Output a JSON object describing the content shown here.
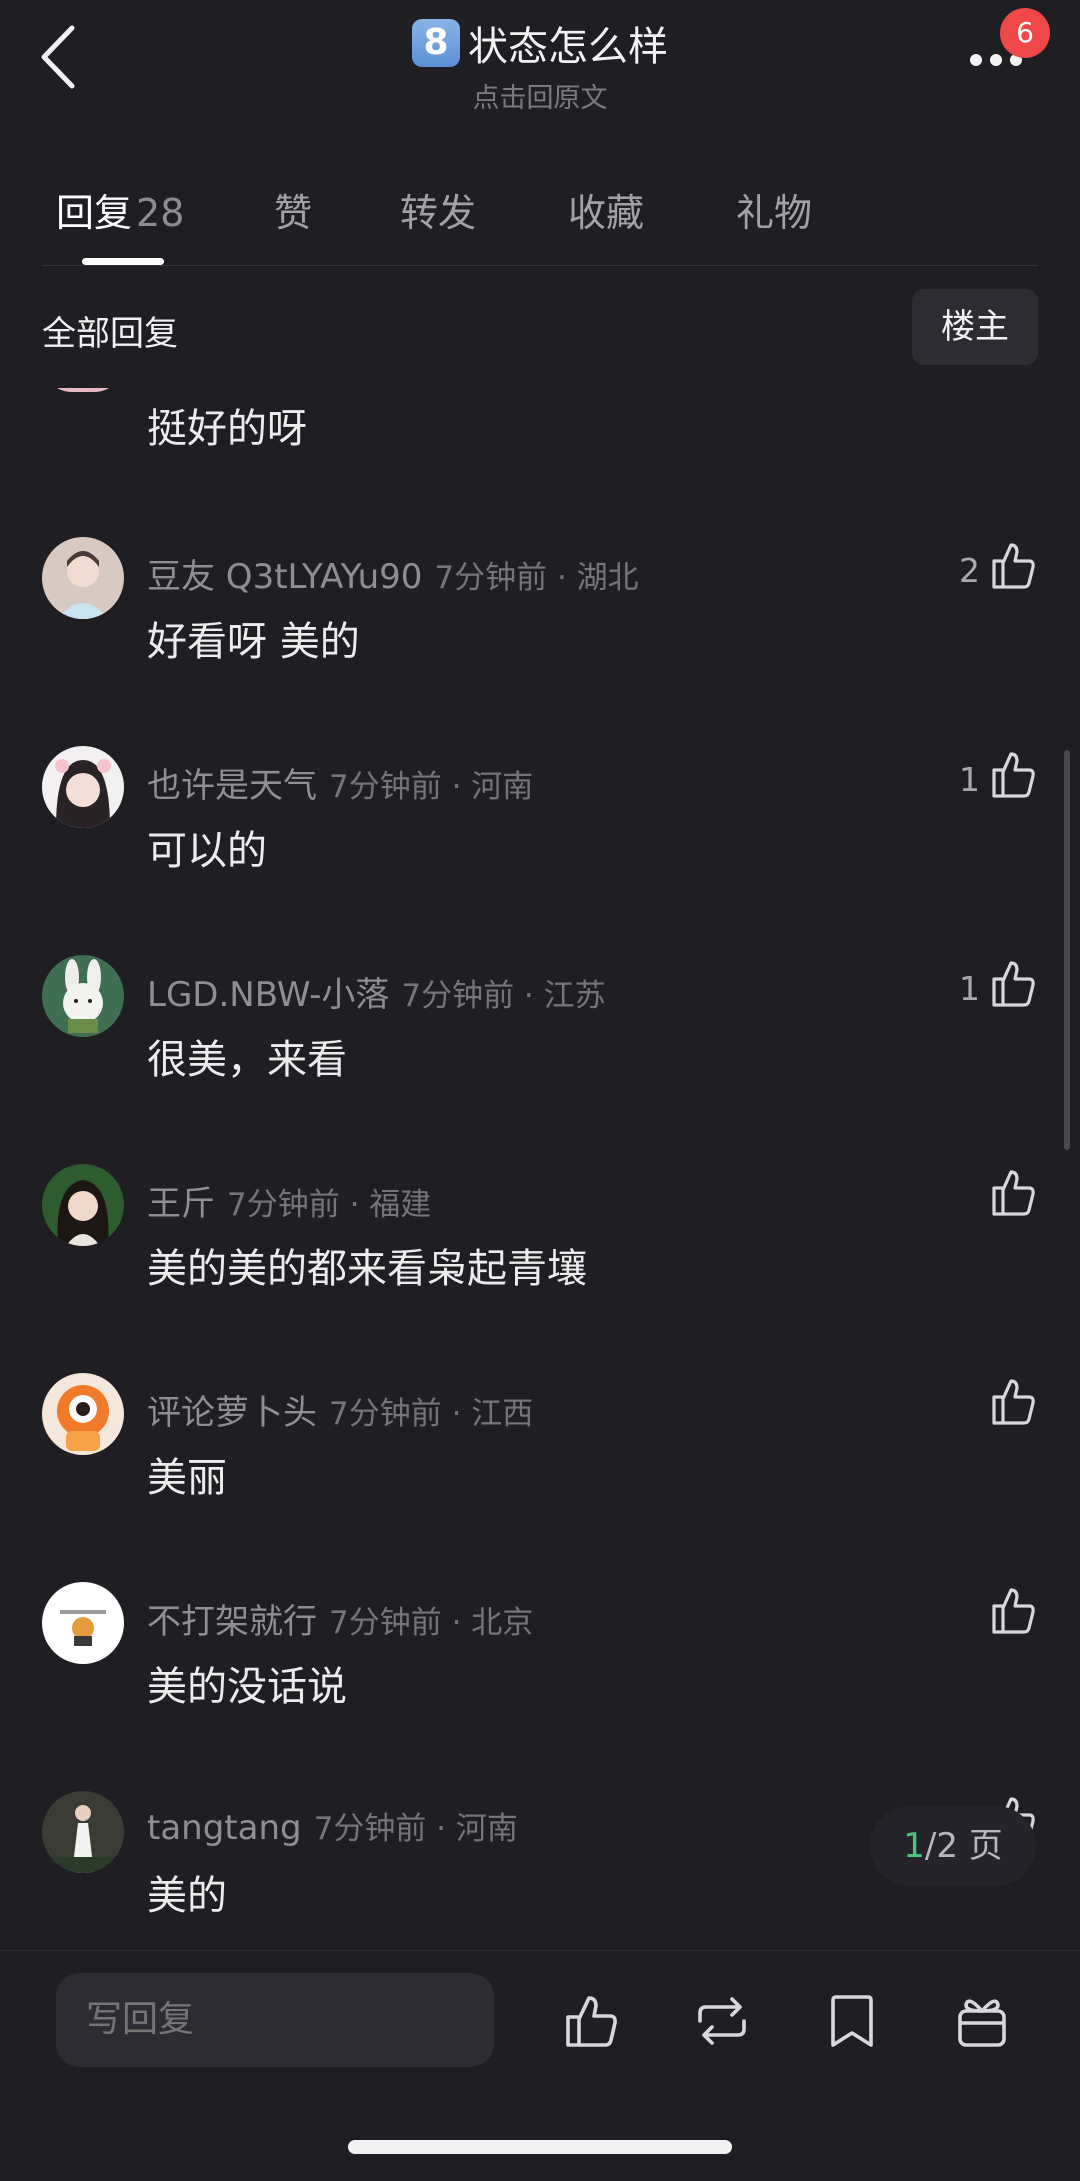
{
  "header": {
    "emoji": "8",
    "title": "状态怎么样",
    "subtitle": "点击回原文",
    "notification_count": "6"
  },
  "tabs": [
    {
      "label": "回复",
      "count": "28",
      "active": true
    },
    {
      "label": "赞"
    },
    {
      "label": "转发"
    },
    {
      "label": "收藏"
    },
    {
      "label": "礼物"
    }
  ],
  "filter": {
    "section_title": "全部回复",
    "owner_button": "楼主"
  },
  "partial_comment": {
    "text": "挺好的呀"
  },
  "comments": [
    {
      "username": "豆友 Q3tLYAYu90",
      "time": "7分钟前 · 湖北",
      "text": "好看呀 美的",
      "likes": "2"
    },
    {
      "username": "也许是天气",
      "time": "7分钟前 · 河南",
      "text": "可以的",
      "likes": "1"
    },
    {
      "username": "LGD.NBW-小落",
      "time": "7分钟前 · 江苏",
      "text": "很美，来看",
      "likes": "1"
    },
    {
      "username": "王斤",
      "time": "7分钟前 · 福建",
      "text": "美的美的都来看枭起青壤",
      "likes": ""
    },
    {
      "username": "评论萝卜头",
      "time": "7分钟前 · 江西",
      "text": "美丽",
      "likes": ""
    },
    {
      "username": "不打架就行",
      "time": "7分钟前 · 北京",
      "text": "美的没话说",
      "likes": ""
    },
    {
      "username": "tangtang",
      "time": "7分钟前 · 河南",
      "text": "美的",
      "likes": ""
    }
  ],
  "pagination": {
    "current": "1",
    "total_label": "/2 页"
  },
  "bottom_bar": {
    "reply_placeholder": "写回复"
  },
  "icons": {
    "back": "chevron-left-icon",
    "more": "more-dots-icon",
    "like": "thumbs-up-icon",
    "repost": "repost-icon",
    "bookmark": "bookmark-icon",
    "gift": "gift-icon"
  },
  "colors": {
    "background": "#1f1e23",
    "badge": "#f04848",
    "page_current": "#4cc77a"
  }
}
